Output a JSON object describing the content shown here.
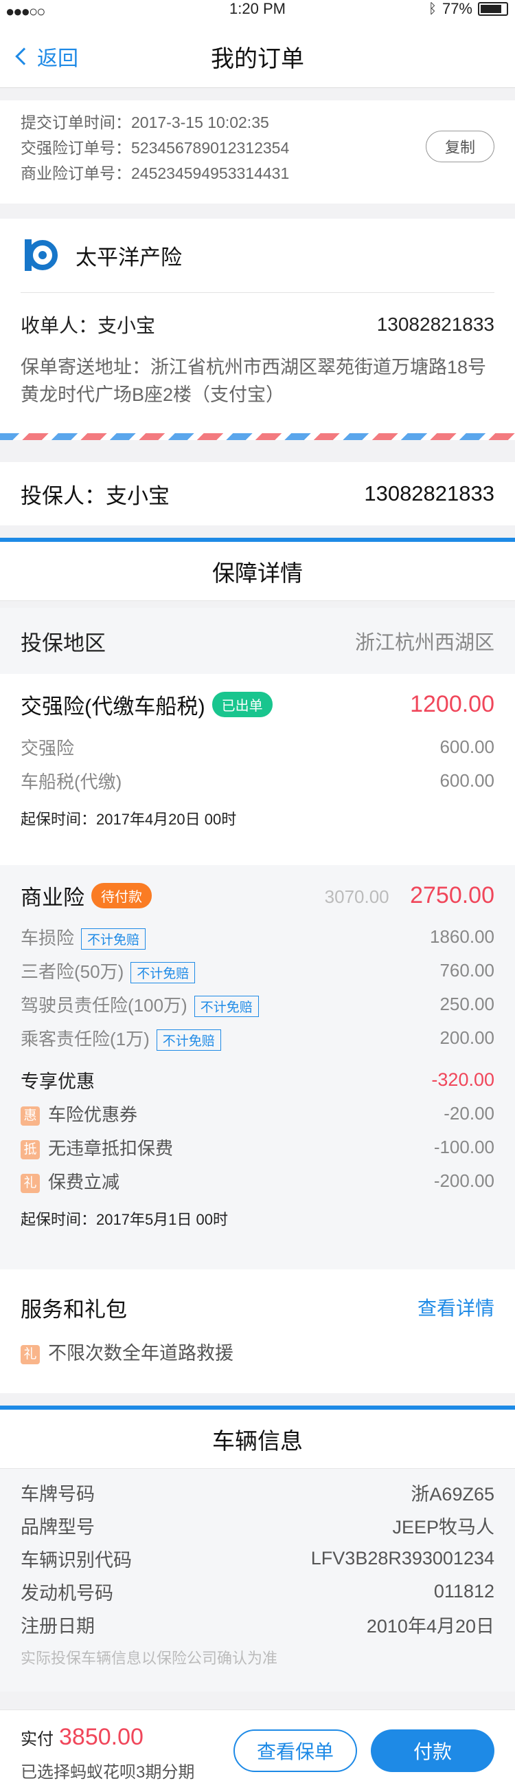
{
  "status_bar": {
    "signal": "●●●○○",
    "time": "1:20 PM",
    "battery": "77%"
  },
  "nav": {
    "back_label": "返回",
    "title": "我的订单"
  },
  "order": {
    "submit_time": "提交订单时间：2017-3-15  10:02:35",
    "compulsory_no": "交强险订单号：523456789012312354",
    "commercial_no": "商业险订单号：245234594953314431",
    "copy_label": "复制"
  },
  "insurer": {
    "name": "太平洋产险",
    "receiver_label": "收单人：支小宝",
    "receiver_phone": "13082821833",
    "address": "保单寄送地址：浙江省杭州市西湖区翠苑街道万塘路18号黄龙时代广场B座2楼（支付宝）"
  },
  "holder": {
    "label": "投保人：支小宝",
    "phone": "13082821833"
  },
  "guarantee": {
    "title": "保障详情",
    "region_label": "投保地区",
    "region_value": "浙江杭州西湖区",
    "compulsory": {
      "title": "交强险(代缴车船税)",
      "badge": "已出单",
      "price": "1200.00",
      "items": [
        {
          "label": "交强险",
          "value": "600.00"
        },
        {
          "label": "车船税(代缴)",
          "value": "600.00"
        }
      ],
      "start": "起保时间：2017年4月20日 00时"
    },
    "commercial": {
      "title": "商业险",
      "badge": "待付款",
      "old_price": "3070.00",
      "price": "2750.00",
      "items": [
        {
          "label": "车损险",
          "tag": "不计免赔",
          "value": "1860.00"
        },
        {
          "label": "三者险(50万)",
          "tag": "不计免赔",
          "value": "760.00"
        },
        {
          "label": "驾驶员责任险(100万)",
          "tag": "不计免赔",
          "value": "250.00"
        },
        {
          "label": "乘客责任险(1万)",
          "tag": "不计免赔",
          "value": "200.00"
        }
      ],
      "discount_title": "专享优惠",
      "discount_total": "-320.00",
      "discounts": [
        {
          "icon": "惠",
          "label": "车险优惠券",
          "value": "-20.00"
        },
        {
          "icon": "抵",
          "label": "无违章抵扣保费",
          "value": "-100.00"
        },
        {
          "icon": "礼",
          "label": "保费立减",
          "value": "-200.00"
        }
      ],
      "start": "起保时间：2017年5月1日 00时"
    },
    "service": {
      "title": "服务和礼包",
      "link": "查看详情",
      "icon": "礼",
      "item": "不限次数全年道路救援"
    }
  },
  "vehicle": {
    "title": "车辆信息",
    "rows": [
      {
        "label": "车牌号码",
        "value": "浙A69Z65"
      },
      {
        "label": "品牌型号",
        "value": "JEEP牧马人"
      },
      {
        "label": "车辆识别代码",
        "value": "LFV3B28R393001234"
      },
      {
        "label": "发动机号码",
        "value": "011812"
      },
      {
        "label": "注册日期",
        "value": "2010年4月20日"
      }
    ],
    "note": "实际投保车辆信息以保险公司确认为准"
  },
  "bottom": {
    "pay_label": "实付",
    "pay_amount": "3850.00",
    "sub": "已选择蚂蚁花呗3期分期",
    "view_label": "查看保单",
    "pay_button": "付款"
  },
  "colors": {
    "accent": "#1e8ae6",
    "price_red": "#f0465a",
    "badge_green": "#19c58e",
    "badge_orange": "#fa7c24"
  }
}
